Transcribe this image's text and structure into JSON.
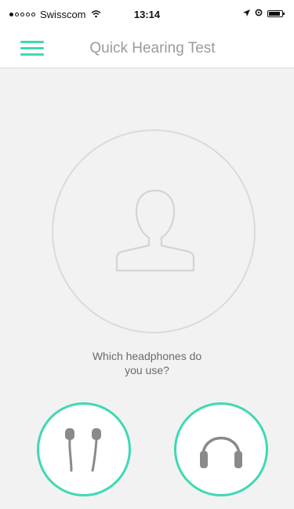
{
  "status_bar": {
    "carrier": "Swisscom",
    "time": "13:14",
    "signal_strength": "1 of 5"
  },
  "nav": {
    "title": "Quick Hearing Test",
    "menu_icon": "hamburger-menu-icon"
  },
  "avatar": {
    "icon": "user-silhouette-icon"
  },
  "question": {
    "line1": "Which headphones do",
    "line2": "you use?"
  },
  "choices": [
    {
      "icon": "earphones-icon"
    },
    {
      "icon": "headphones-icon"
    }
  ],
  "colors": {
    "accent": "#3ed9b4",
    "background": "#f2f2f2",
    "outline": "#dadada",
    "icon_gray": "#8a8a8a"
  }
}
